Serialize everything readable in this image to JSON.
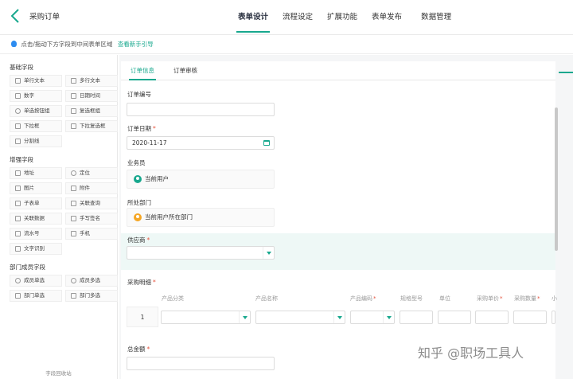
{
  "header": {
    "app_title": "采购订单",
    "tabs": [
      "表单设计",
      "流程设定",
      "扩展功能",
      "表单发布",
      "数据管理"
    ],
    "active_tab": 0
  },
  "hint": {
    "text": "点击/拖动下方字段到中间表单区域",
    "guide_link": "查看新手引导"
  },
  "palette": {
    "groups": [
      {
        "title": "基础字段",
        "items": [
          {
            "label": "单行文本",
            "icon": "single-line-text-icon"
          },
          {
            "label": "多行文本",
            "icon": "multi-line-text-icon"
          },
          {
            "label": "数字",
            "icon": "number-icon"
          },
          {
            "label": "日期时间",
            "icon": "datetime-icon"
          },
          {
            "label": "单选按钮组",
            "icon": "radio-group-icon"
          },
          {
            "label": "复选框组",
            "icon": "checkbox-group-icon"
          },
          {
            "label": "下拉框",
            "icon": "dropdown-icon"
          },
          {
            "label": "下拉复选框",
            "icon": "dropdown-checkbox-icon"
          },
          {
            "label": "分割线",
            "icon": "divider-icon"
          }
        ]
      },
      {
        "title": "增强字段",
        "items": [
          {
            "label": "地址",
            "icon": "address-icon"
          },
          {
            "label": "定位",
            "icon": "location-icon"
          },
          {
            "label": "图片",
            "icon": "image-icon"
          },
          {
            "label": "附件",
            "icon": "attachment-icon"
          },
          {
            "label": "子表单",
            "icon": "subform-icon"
          },
          {
            "label": "关联查询",
            "icon": "linked-query-icon"
          },
          {
            "label": "关联数据",
            "icon": "linked-data-icon"
          },
          {
            "label": "手写签名",
            "icon": "signature-icon"
          },
          {
            "label": "流水号",
            "icon": "serial-number-icon"
          },
          {
            "label": "手机",
            "icon": "phone-icon"
          },
          {
            "label": "文字识别",
            "icon": "ocr-icon"
          }
        ]
      },
      {
        "title": "部门成员字段",
        "items": [
          {
            "label": "成员单选",
            "icon": "member-single-icon"
          },
          {
            "label": "成员多选",
            "icon": "member-multi-icon"
          },
          {
            "label": "部门单选",
            "icon": "dept-single-icon"
          },
          {
            "label": "部门多选",
            "icon": "dept-multi-icon"
          }
        ]
      }
    ],
    "footer": "字段回收站"
  },
  "form": {
    "tabs": [
      "订单信息",
      "订单审核"
    ],
    "fields": {
      "order_no": {
        "label": "订单编号",
        "value": ""
      },
      "order_date": {
        "label": "订单日期",
        "required": "*",
        "value": "2020-11-17"
      },
      "salesperson": {
        "label": "业务员",
        "value": "当前用户"
      },
      "department": {
        "label": "所处部门",
        "value": "当前用户所在部门"
      },
      "supplier": {
        "label": "供应商",
        "required": "*"
      },
      "detail": {
        "label": "采购明细",
        "required": "*"
      },
      "total": {
        "label": "总金额",
        "required": "*"
      }
    },
    "subtable": {
      "columns": [
        {
          "label": "产品分类",
          "req": ""
        },
        {
          "label": "产品名称",
          "req": ""
        },
        {
          "label": "产品编码",
          "req": "*"
        },
        {
          "label": "规格型号",
          "req": ""
        },
        {
          "label": "单位",
          "req": ""
        },
        {
          "label": "采购单价",
          "req": "*"
        },
        {
          "label": "采购数量",
          "req": "*"
        },
        {
          "label": "小",
          "req": ""
        }
      ],
      "row_number": "1"
    }
  },
  "watermark": "知乎 @职场工具人",
  "colors": {
    "accent": "#18a88e",
    "required": "#e5533d"
  }
}
